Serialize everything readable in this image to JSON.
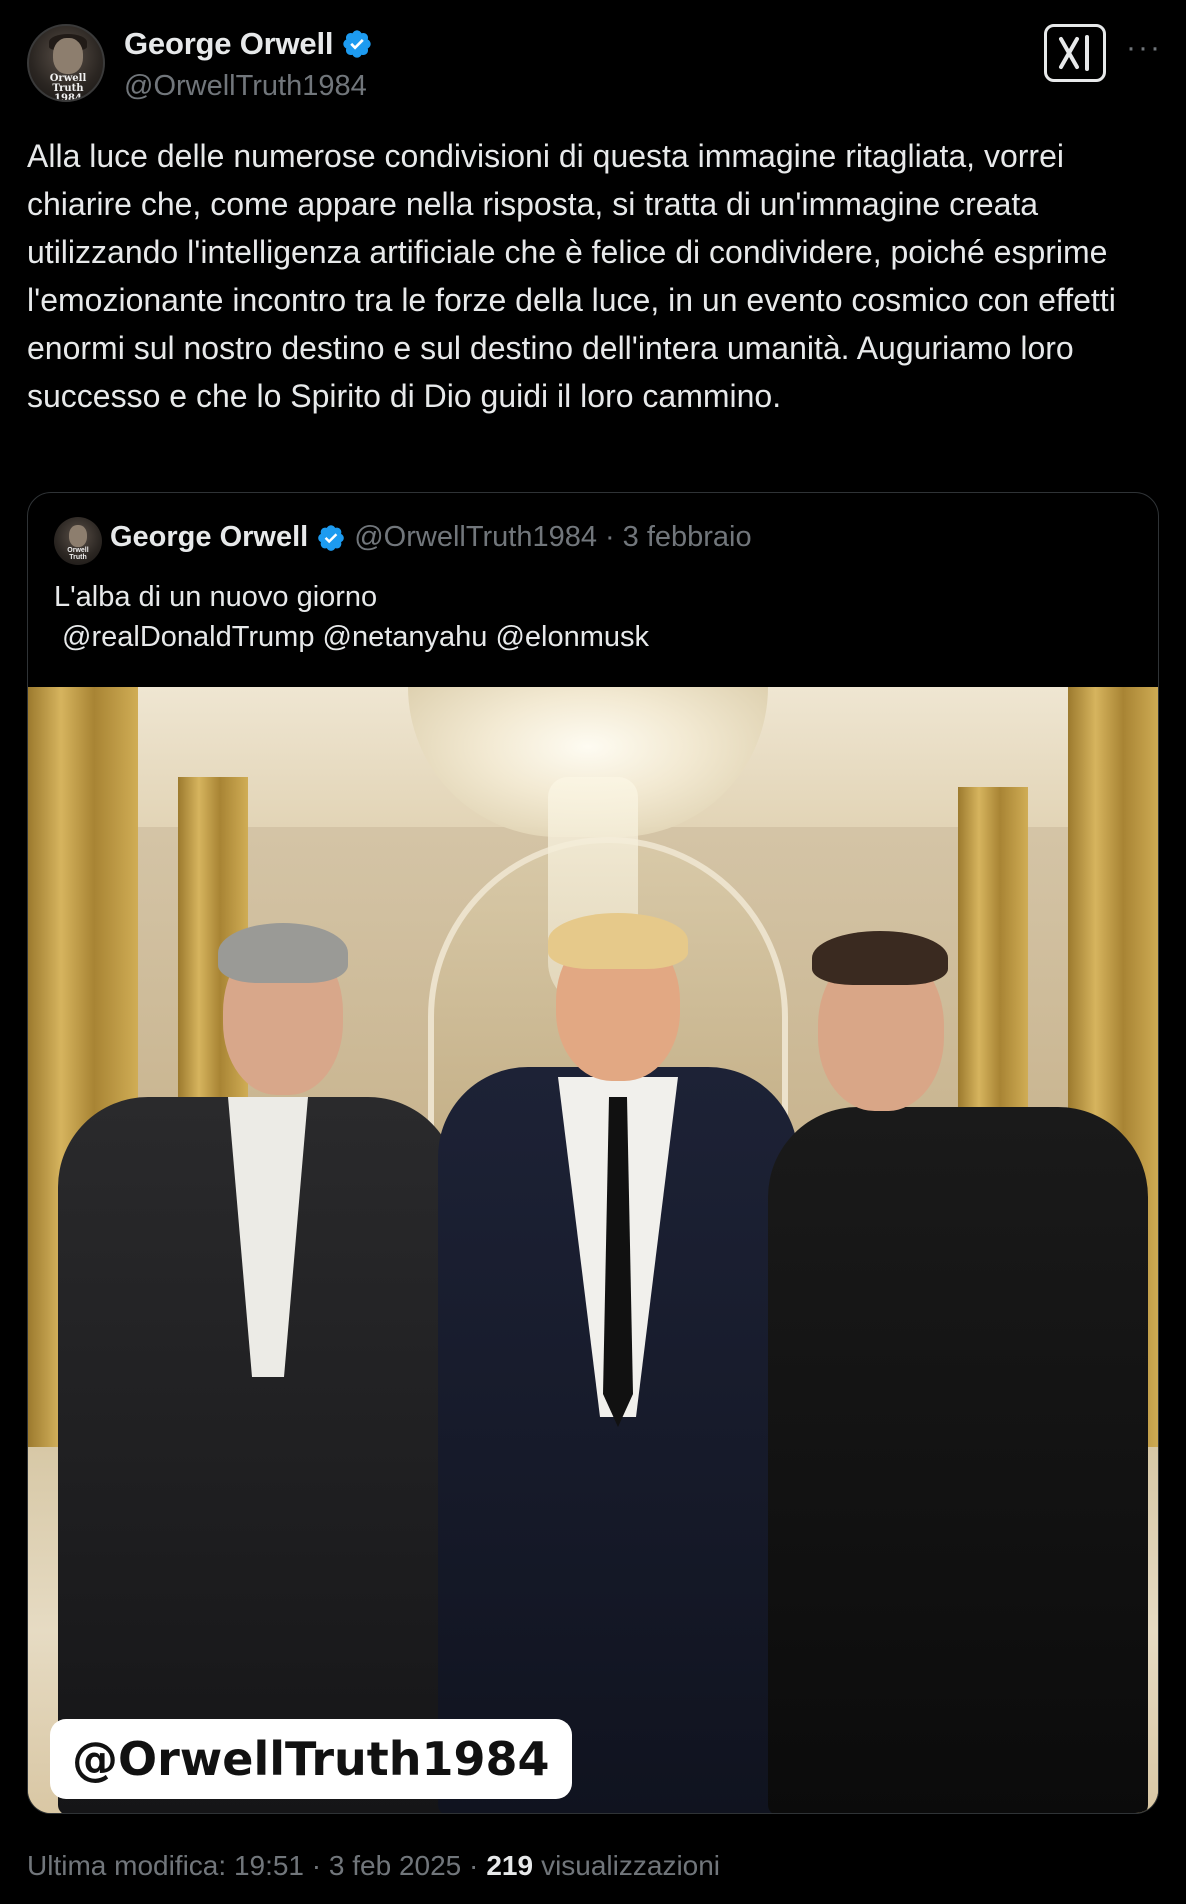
{
  "tweet": {
    "author_name": "George Orwell",
    "author_handle": "@OrwellTruth1984",
    "avatar_text": "Orwell Truth",
    "avatar_subtext": "1984",
    "body": "Alla luce delle numerose condivisioni di questa immagine ritagliata, vorrei chiarire che, come appare nella risposta, si tratta di un'immagine creata utilizzando l'intelligenza artificiale che è felice di condividere, poiché esprime l'emozionante incontro tra le forze della luce, in un evento cosmico con effetti enormi sul nostro destino e sul destino dell'intera umanità. Auguriamo loro successo e che lo Spirito di Dio guidi il loro cammino.",
    "more_label": "···"
  },
  "quote": {
    "author_name": "George Orwell",
    "author_handle": "@OrwellTruth1984",
    "separator": "·",
    "date": "3 febbraio",
    "text_line1": "L'alba di un nuovo giorno",
    "text_line2": " @realDonaldTrump @netanyahu @elonmusk",
    "image_watermark": "@OrwellTruth1984"
  },
  "footer": {
    "edited_label": "Ultima modifica: 19:51 · 3 feb 2025 ·",
    "views_count": "219",
    "views_label": "visualizzazioni"
  },
  "colors": {
    "background": "#000000",
    "text_primary": "#e7e9ea",
    "text_secondary": "#71767b",
    "verified_blue": "#1d9bf0",
    "border": "#2f3336"
  },
  "icons": [
    "verified-badge-icon",
    "x-grok-icon",
    "more-icon"
  ]
}
